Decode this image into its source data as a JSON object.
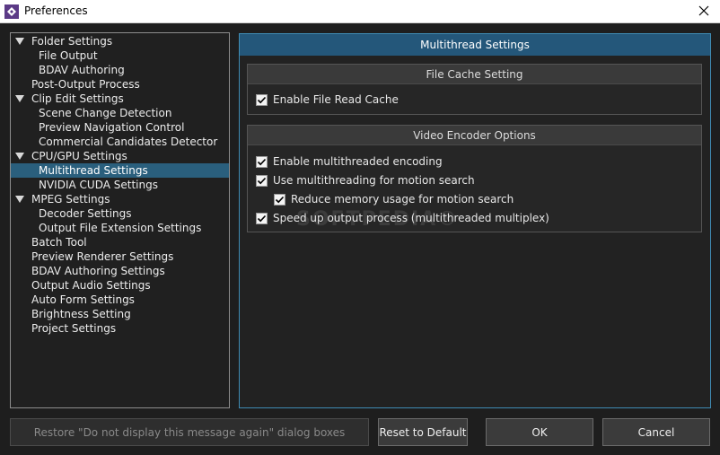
{
  "window": {
    "title": "Preferences"
  },
  "tree": {
    "items": [
      {
        "label": "Folder Settings",
        "level": 0,
        "expandable": true
      },
      {
        "label": "File Output",
        "level": 1
      },
      {
        "label": "BDAV Authoring",
        "level": 1
      },
      {
        "label": "Post-Output Process",
        "level": 0
      },
      {
        "label": "Clip Edit Settings",
        "level": 0,
        "expandable": true
      },
      {
        "label": "Scene Change Detection",
        "level": 1
      },
      {
        "label": "Preview Navigation Control",
        "level": 1
      },
      {
        "label": "Commercial Candidates Detector",
        "level": 1
      },
      {
        "label": "CPU/GPU Settings",
        "level": 0,
        "expandable": true
      },
      {
        "label": "Multithread Settings",
        "level": 1,
        "selected": true
      },
      {
        "label": "NVIDIA CUDA Settings",
        "level": 1
      },
      {
        "label": "MPEG Settings",
        "level": 0,
        "expandable": true
      },
      {
        "label": "Decoder Settings",
        "level": 1
      },
      {
        "label": "Output File Extension Settings",
        "level": 1
      },
      {
        "label": "Batch Tool",
        "level": 0
      },
      {
        "label": "Preview Renderer Settings",
        "level": 0
      },
      {
        "label": "BDAV Authoring Settings",
        "level": 0
      },
      {
        "label": "Output Audio Settings",
        "level": 0
      },
      {
        "label": "Auto Form Settings",
        "level": 0
      },
      {
        "label": "Brightness Setting",
        "level": 0
      },
      {
        "label": "Project Settings",
        "level": 0
      }
    ]
  },
  "panel": {
    "title": "Multithread Settings",
    "file_cache": {
      "title": "File Cache Setting",
      "enable_read_cache": {
        "label": "Enable File Read Cache",
        "checked": true
      }
    },
    "video_encoder": {
      "title": "Video Encoder Options",
      "multithreaded_encoding": {
        "label": "Enable multithreaded encoding",
        "checked": true
      },
      "motion_search": {
        "label": "Use multithreading for motion search",
        "checked": true
      },
      "reduce_memory": {
        "label": "Reduce memory usage for motion search",
        "checked": true
      },
      "speed_up_output": {
        "label": "Speed up output process (multithreaded multiplex)",
        "checked": true
      }
    }
  },
  "watermark": "SOFTPEDIA®",
  "buttons": {
    "restore": "Restore \"Do not display this message again\" dialog boxes",
    "reset": "Reset to Default",
    "ok": "OK",
    "cancel": "Cancel"
  },
  "colors": {
    "background": "#1e1e1e",
    "accent": "#24577a",
    "selection": "#2a5f7d",
    "panel_border": "#3f8bb3"
  }
}
